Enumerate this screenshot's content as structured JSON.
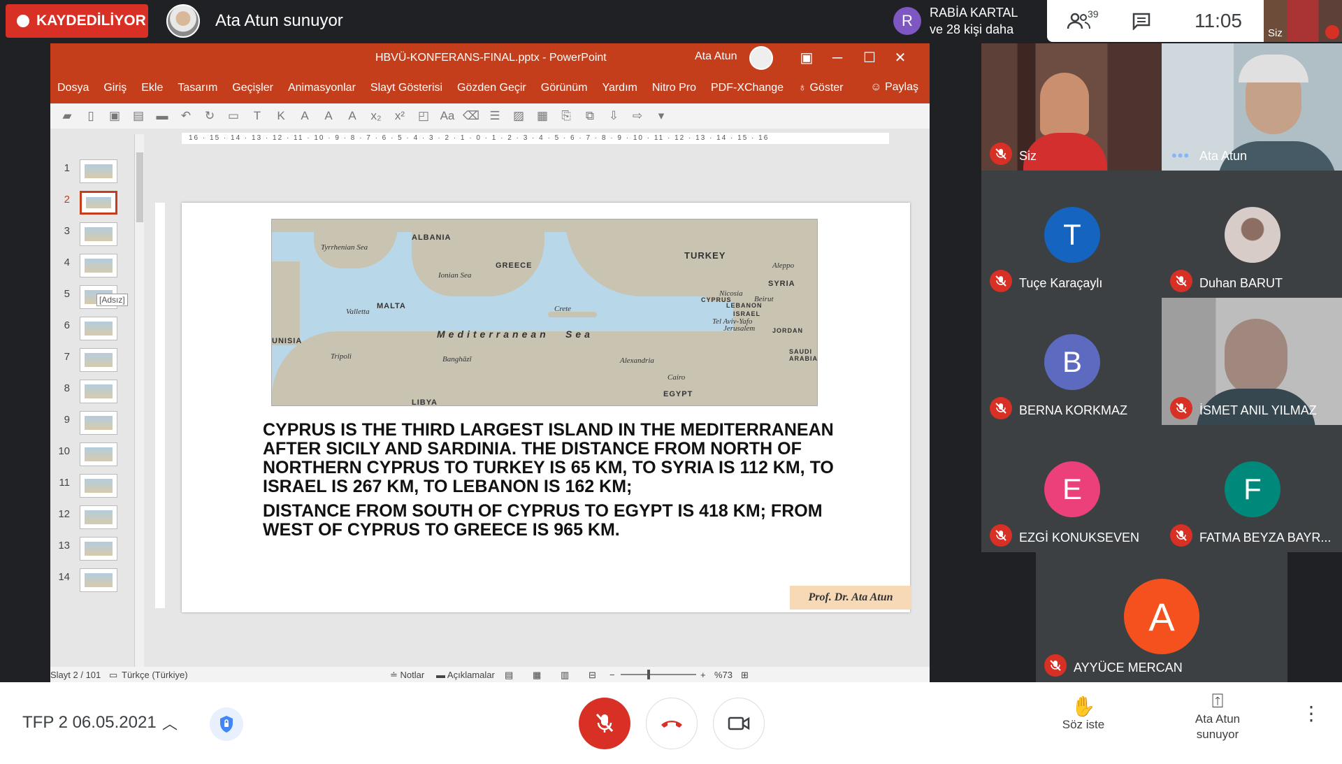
{
  "recording": {
    "label": "KAYDEDİLİYOR"
  },
  "presenter": {
    "title": "Ata Atun sunuyor"
  },
  "viewer": {
    "initial": "R",
    "line1": "RABİA KARTAL",
    "line2": "ve 28 kişi daha"
  },
  "topbar": {
    "people_count": "39",
    "time": "11:05",
    "self_label": "Siz"
  },
  "ppt": {
    "title": "HBVÜ-KONFERANS-FINAL.pptx  -  PowerPoint",
    "user": "Ata Atun",
    "menu": [
      "Dosya",
      "Giriş",
      "Ekle",
      "Tasarım",
      "Geçişler",
      "Animasyonlar",
      "Slayt Gösterisi",
      "Gözden Geçir",
      "Görünüm",
      "Yardım",
      "Nitro Pro",
      "PDF-XChange",
      "Göster"
    ],
    "share": "Paylaş",
    "tooltip": "[Adsız]",
    "thumb_numbers": [
      "1",
      "2",
      "3",
      "4",
      "5",
      "6",
      "7",
      "8",
      "9",
      "10",
      "11",
      "12",
      "13",
      "14"
    ],
    "ruler": "16 · 15 · 14 · 13 · 12 · 11 · 10 · 9 · 8 · 7 · 6 · 5 · 4 · 3 · 2 · 1 · 0 · 1 · 2 · 3 · 4 · 5 · 6 · 7 · 8 · 9 · 10 · 11 · 12 · 13 · 14 · 15 · 16",
    "status": {
      "slide": "Slayt 2 / 101",
      "language": "Türkçe (Türkiye)",
      "notes": "Notlar",
      "comments": "Açıklamalar",
      "zoom": "%73"
    }
  },
  "slide": {
    "paragraph1": "CYPRUS IS THE THIRD LARGEST ISLAND IN THE MEDITERRANEAN AFTER SICILY AND SARDINIA. THE DISTANCE FROM NORTH OF NORTHERN CYPRUS TO TURKEY IS 65 KM, TO SYRIA IS 112 KM, TO ISRAEL IS 267 KM, TO LEBANON IS 162 KM;",
    "paragraph2": "DISTANCE FROM SOUTH OF CYPRUS TO EGYPT IS 418 KM; FROM WEST OF CYPRUS TO GREECE IS 965 KM.",
    "signature": "Prof. Dr. Ata Atun",
    "map_labels": {
      "turkey": "TURKEY",
      "syria": "SYRIA",
      "mediterranean": "Mediterranean",
      "sea": "Sea",
      "tyrrhenian": "Tyrrhenian Sea",
      "ionian": "Ionian Sea",
      "valletta": "Valletta",
      "malta": "MALTA",
      "tunisia": "UNISIA",
      "tripoli": "Tripoli",
      "benghazi": "Banghāzī",
      "libya": "LIBYA",
      "crete": "Crete",
      "alexandria": "Alexandria",
      "egypt": "EGYPT",
      "cairo": "Cairo",
      "nicosia": "Nicosia",
      "cyprus": "CYPRUS",
      "beirut": "Beirut",
      "lebanon": "LEBANON",
      "israel": "ISRAEL",
      "telaviv": "Tel Aviv-Yafo",
      "jerusalem": "Jerusalem",
      "jordan": "JORDAN",
      "saudi": "SAUDI ARABIA",
      "aleppo": "Aleppo",
      "albania": "ALBANIA",
      "greece": "GREECE"
    }
  },
  "participants": [
    {
      "name": "Siz"
    },
    {
      "name": "Ata Atun"
    },
    {
      "name": "Tuçe Karaçaylı",
      "initial": "T",
      "color": "#1565c0"
    },
    {
      "name": "Duhan BARUT"
    },
    {
      "name": "BERNA KORKMAZ",
      "initial": "B",
      "color": "#5c6bc0"
    },
    {
      "name": "İSMET ANIL YILMAZ"
    },
    {
      "name": "EZGİ KONUKSEVEN",
      "initial": "E",
      "color": "#ec407a"
    },
    {
      "name": "FATMA BEYZA BAYR...",
      "initial": "F",
      "color": "#00897b"
    },
    {
      "name": "AYYÜCE MERCAN",
      "initial": "A",
      "color": "#f4511e"
    }
  ],
  "bottom": {
    "meeting_name": "TFP 2 06.05.2021",
    "raise_hand": "Söz iste",
    "presenting_line1": "Ata Atun",
    "presenting_line2": "sunuyor"
  },
  "icons": {
    "recording": "record-dot-icon",
    "people": "people-icon",
    "chat": "chat-icon",
    "mic_off": "mic-off-icon",
    "hangup": "hangup-icon",
    "camera": "camera-icon",
    "hand": "hand-icon",
    "present": "present-icon",
    "more": "more-vert-icon",
    "shield": "shield-icon"
  },
  "colors": {
    "ppt_accent": "#c43e1c",
    "meet_red": "#d93025",
    "meet_dark": "#202124",
    "tile": "#3c4043"
  }
}
